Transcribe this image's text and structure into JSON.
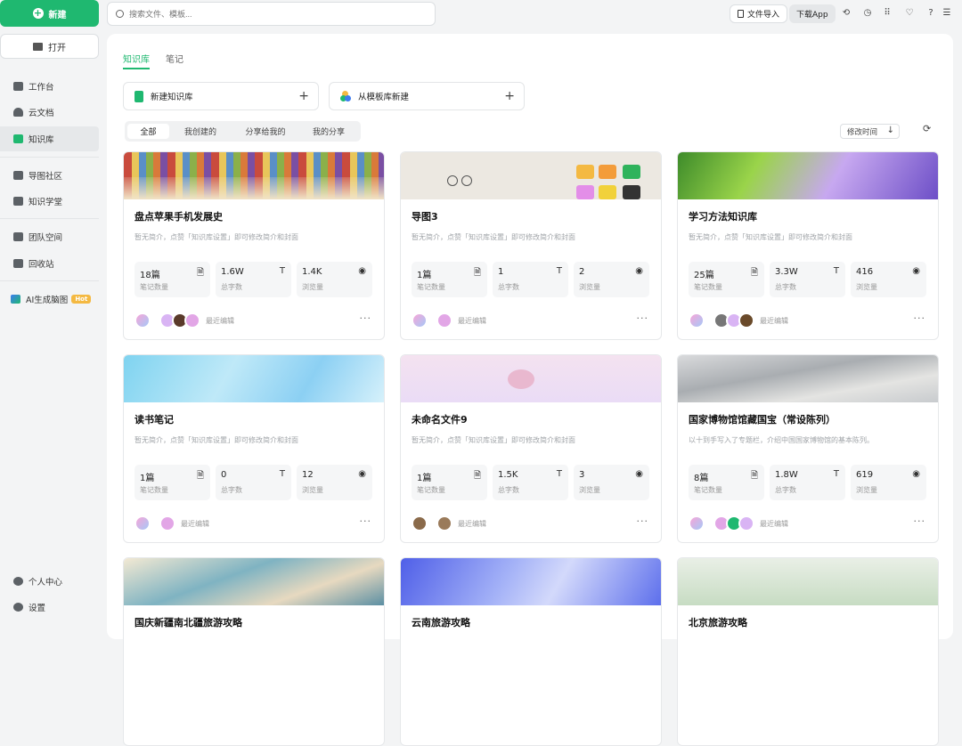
{
  "sidebar": {
    "new_label": "新建",
    "open_label": "打开",
    "items": [
      {
        "label": "工作台",
        "icon": "monitor-icon"
      },
      {
        "label": "云文档",
        "icon": "cloud-icon"
      },
      {
        "label": "知识库",
        "icon": "knowledge-base-icon"
      },
      {
        "label": "导图社区",
        "icon": "community-icon"
      },
      {
        "label": "知识学堂",
        "icon": "graduation-cap-icon"
      },
      {
        "label": "团队空间",
        "icon": "team-space-icon"
      },
      {
        "label": "回收站",
        "icon": "trash-icon"
      },
      {
        "label": "AI生成脑图",
        "icon": "ai-icon"
      }
    ],
    "hot_badge": "Hot",
    "bottom": [
      {
        "label": "个人中心",
        "icon": "user-icon"
      },
      {
        "label": "设置",
        "icon": "settings-icon"
      }
    ]
  },
  "topbar": {
    "search_placeholder": "搜索文件、模板...",
    "import_label": "文件导入",
    "download_label": "下载App"
  },
  "main": {
    "tabs": [
      "知识库",
      "笔记"
    ],
    "create_new_kb": "新建知识库",
    "create_from_template": "从模板库新建",
    "filters": [
      "全部",
      "我创建的",
      "分享给我的",
      "我的分享"
    ],
    "sort_label": "修改时间",
    "recent_label": "最近编辑",
    "cards": [
      {
        "title": "盘点苹果手机发展史",
        "desc": "暂无简介，点赞「知识库设置」即可修改简介和封面",
        "stats": [
          {
            "value": "18篇",
            "label": "笔记数量"
          },
          {
            "value": "1.6W",
            "label": "总字数"
          },
          {
            "value": "1.4K",
            "label": "浏览量"
          }
        ]
      },
      {
        "title": "导图3",
        "desc": "暂无简介，点赞「知识库设置」即可修改简介和封面",
        "stats": [
          {
            "value": "1篇",
            "label": "笔记数量"
          },
          {
            "value": "1",
            "label": "总字数"
          },
          {
            "value": "2",
            "label": "浏览量"
          }
        ]
      },
      {
        "title": "学习方法知识库",
        "desc": "暂无简介，点赞「知识库设置」即可修改简介和封面",
        "stats": [
          {
            "value": "25篇",
            "label": "笔记数量"
          },
          {
            "value": "3.3W",
            "label": "总字数"
          },
          {
            "value": "416",
            "label": "浏览量"
          }
        ]
      },
      {
        "title": "读书笔记",
        "desc": "暂无简介，点赞「知识库设置」即可修改简介和封面",
        "stats": [
          {
            "value": "1篇",
            "label": "笔记数量"
          },
          {
            "value": "0",
            "label": "总字数"
          },
          {
            "value": "12",
            "label": "浏览量"
          }
        ]
      },
      {
        "title": "未命名文件9",
        "desc": "暂无简介，点赞「知识库设置」即可修改简介和封面",
        "stats": [
          {
            "value": "1篇",
            "label": "笔记数量"
          },
          {
            "value": "1.5K",
            "label": "总字数"
          },
          {
            "value": "3",
            "label": "浏览量"
          }
        ]
      },
      {
        "title": "国家博物馆馆藏国宝（常设陈列）",
        "desc": "以十到手写入了专题栏，介绍中国国家博物馆的基本陈列。",
        "stats": [
          {
            "value": "8篇",
            "label": "笔记数量"
          },
          {
            "value": "1.8W",
            "label": "总字数"
          },
          {
            "value": "619",
            "label": "浏览量"
          }
        ]
      },
      {
        "title": "国庆新疆南北疆旅游攻略"
      },
      {
        "title": "云南旅游攻略"
      },
      {
        "title": "北京旅游攻略"
      }
    ]
  },
  "colors": {
    "brand": "#1fb870"
  }
}
